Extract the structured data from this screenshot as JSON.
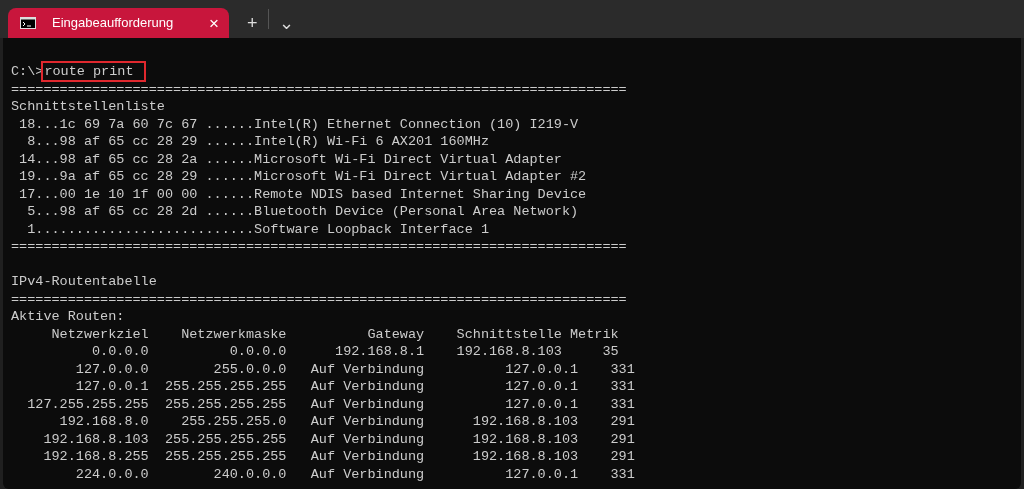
{
  "tabs": [
    {
      "title": "Eingabeaufforderung",
      "selected": true,
      "close": "×"
    }
  ],
  "new_tab": "+",
  "dropdown": "⌄",
  "terminal": {
    "prompt": "C:\\>",
    "command": "route print",
    "command_highlighted": true,
    "blocks": [
      {
        "lines": [
          "============================================================================",
          "Schnittstellenliste",
          " 18...1c 69 7a 60 7c 67 ......Intel(R) Ethernet Connection (10) I219-V",
          "  8...98 af 65 cc 28 29 ......Intel(R) Wi-Fi 6 AX201 160MHz",
          " 14...98 af 65 cc 28 2a ......Microsoft Wi-Fi Direct Virtual Adapter",
          " 19...9a af 65 cc 28 29 ......Microsoft Wi-Fi Direct Virtual Adapter #2",
          " 17...00 1e 10 1f 00 00 ......Remote NDIS based Internet Sharing Device",
          "  5...98 af 65 cc 28 2d ......Bluetooth Device (Personal Area Network)",
          "  1...........................Software Loopback Interface 1",
          "============================================================================"
        ]
      },
      {
        "lines": [
          "IPv4-Routentabelle",
          "============================================================================",
          "Aktive Routen:",
          "     Netzwerkziel    Netzwerkmaske          Gateway    Schnittstelle Metrik",
          "          0.0.0.0          0.0.0.0      192.168.8.1    192.168.8.103     35",
          "        127.0.0.0        255.0.0.0   Auf Verbindung          127.0.0.1    331",
          "        127.0.0.1  255.255.255.255   Auf Verbindung          127.0.0.1    331",
          "  127.255.255.255  255.255.255.255   Auf Verbindung          127.0.0.1    331",
          "      192.168.8.0    255.255.255.0   Auf Verbindung      192.168.8.103    291",
          "    192.168.8.103  255.255.255.255   Auf Verbindung      192.168.8.103    291",
          "    192.168.8.255  255.255.255.255   Auf Verbindung      192.168.8.103    291",
          "        224.0.0.0        240.0.0.0   Auf Verbindung          127.0.0.1    331"
        ]
      }
    ]
  }
}
